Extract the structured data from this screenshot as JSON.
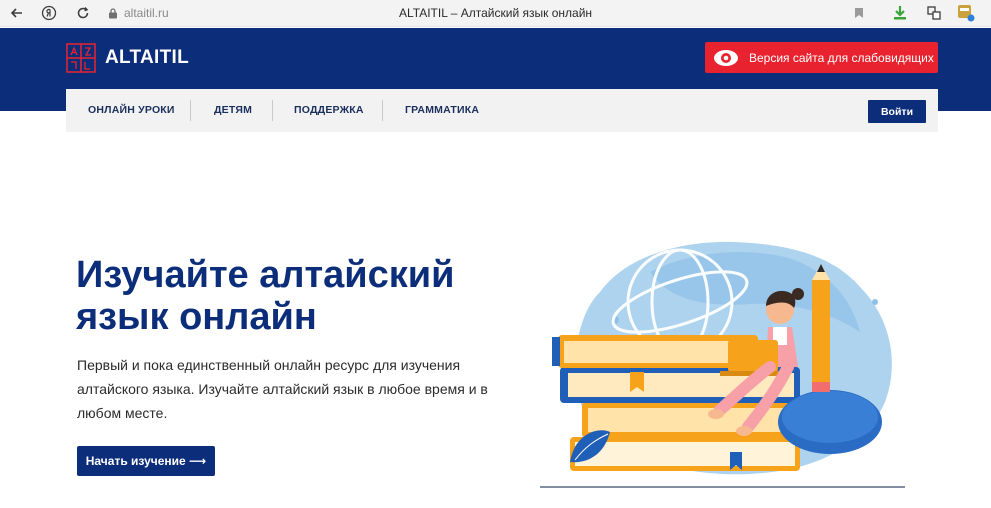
{
  "browser": {
    "url": "altaitil.ru",
    "tab_title": "ALTAITIL – Алтайский язык онлайн",
    "icons": [
      "back-arrow-icon",
      "yandex-icon",
      "reload-icon",
      "lock-icon",
      "bookmark-icon",
      "download-icon",
      "extensions-icon",
      "profile-icon"
    ]
  },
  "header": {
    "logo_text": "ALTAITIL",
    "vision_button_label": "Версия сайта для слабовидящих"
  },
  "nav": {
    "items": [
      {
        "label": "ОНЛАЙН УРОКИ"
      },
      {
        "label": "ДЕТЯМ"
      },
      {
        "label": "ПОДДЕРЖКА"
      },
      {
        "label": "ГРАММАТИКА"
      }
    ],
    "login_label": "Войти"
  },
  "hero": {
    "title_line1": "Изучайте алтайский",
    "title_line2": "язык онлайн",
    "description": "Первый и пока единственный онлайн ресурс для изучения алтайского языка. Изучайте алтайский язык в любое время и в любом месте.",
    "cta_label": "Начать изучение ⟶"
  },
  "colors": {
    "brand_navy": "#0c2e7a",
    "vision_red": "#e8232f",
    "nav_bg": "#f2f2f2",
    "book_orange": "#f6a21a",
    "book_blue": "#1f5fb8"
  }
}
